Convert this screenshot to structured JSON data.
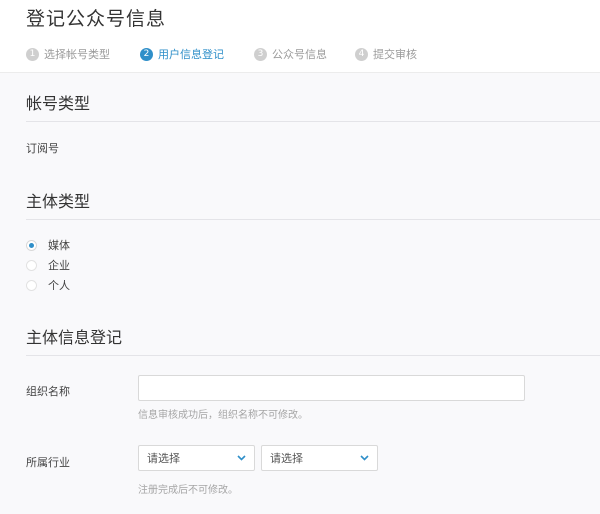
{
  "page": {
    "title": "登记公众号信息"
  },
  "steps": [
    {
      "num": "1",
      "label": "选择帐号类型",
      "active": false
    },
    {
      "num": "2",
      "label": "用户信息登记",
      "active": true
    },
    {
      "num": "3",
      "label": "公众号信息",
      "active": false
    },
    {
      "num": "4",
      "label": "提交审核",
      "active": false
    }
  ],
  "account_type": {
    "title": "帐号类型",
    "value": "订阅号"
  },
  "subject_type": {
    "title": "主体类型",
    "options": [
      {
        "label": "媒体",
        "checked": true
      },
      {
        "label": "企业",
        "checked": false
      },
      {
        "label": "个人",
        "checked": false
      }
    ]
  },
  "subject_info": {
    "title": "主体信息登记",
    "org_name": {
      "label": "组织名称",
      "value": "",
      "hint": "信息审核成功后，组织名称不可修改。"
    },
    "industry": {
      "label": "所属行业",
      "select1": "请选择",
      "select2": "请选择",
      "hint": "注册完成后不可修改。"
    }
  },
  "colors": {
    "accent": "#2f8fc9",
    "panel_bg": "#f9f9fb"
  }
}
